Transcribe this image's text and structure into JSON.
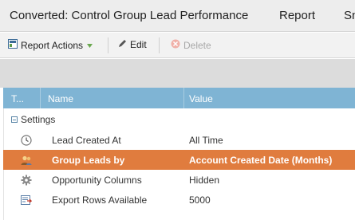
{
  "window": {
    "title": "Converted: Control Group Lead Performance",
    "nav_report": "Report",
    "nav_cut": "Sn"
  },
  "toolbar": {
    "report_actions": "Report Actions",
    "edit": "Edit",
    "delete": "Delete"
  },
  "table": {
    "columns": [
      "T...",
      "Name",
      "Value"
    ],
    "group_label": "Settings",
    "rows": [
      {
        "icon": "clock-icon",
        "name": "Lead Created At",
        "value": "All Time",
        "selected": false
      },
      {
        "icon": "people-icon",
        "name": "Group Leads by",
        "value": "Account Created Date (Months)",
        "selected": true
      },
      {
        "icon": "gear-icon",
        "name": "Opportunity Columns",
        "value": "Hidden",
        "selected": false
      },
      {
        "icon": "export-icon",
        "name": "Export Rows Available",
        "value": "5000",
        "selected": false
      }
    ]
  },
  "colors": {
    "header_bg": "#7fb4d4",
    "selected_row_bg": "#e07c3e"
  }
}
